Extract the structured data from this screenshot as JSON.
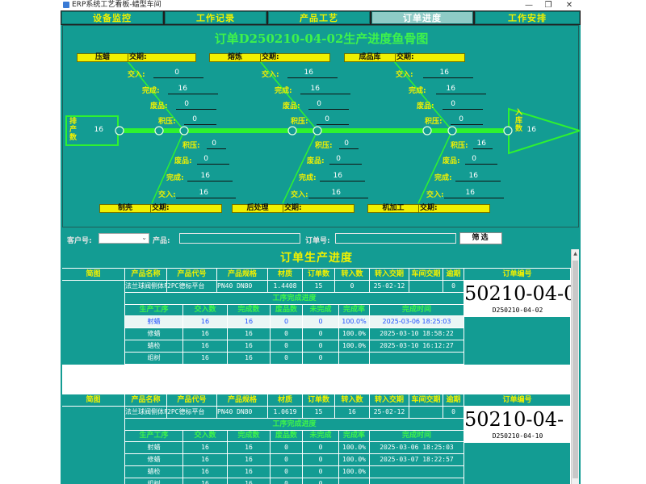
{
  "window": {
    "title": "ERP系统工艺看板-蜡型车间",
    "min_glyph": "—",
    "max_glyph": "❐",
    "close_glyph": "✕"
  },
  "tabs": [
    {
      "label": "设备监控",
      "active": false
    },
    {
      "label": "工作记录",
      "active": false
    },
    {
      "label": "产品工艺",
      "active": false
    },
    {
      "label": "订单进度",
      "active": true
    },
    {
      "label": "工作安排",
      "active": false
    }
  ],
  "fishbone": {
    "title": "订单D250210-04-02生产进度鱼骨图",
    "head": {
      "label": "排产数",
      "value": "16"
    },
    "tail": {
      "label": "入库数",
      "value": "16"
    },
    "date_label": "交期:",
    "top": [
      {
        "name": "压蜡",
        "date": "",
        "stats": [
          {
            "label": "交入:",
            "value": "0"
          },
          {
            "label": "完成:",
            "value": "16"
          },
          {
            "label": "废品:",
            "value": "0"
          },
          {
            "label": "积压:",
            "value": "0"
          }
        ]
      },
      {
        "name": "熔炼",
        "date": "",
        "stats": [
          {
            "label": "交入:",
            "value": "16"
          },
          {
            "label": "完成:",
            "value": "16"
          },
          {
            "label": "废品:",
            "value": "0"
          },
          {
            "label": "积压:",
            "value": "0"
          }
        ]
      },
      {
        "name": "成品库",
        "date": "",
        "stats": [
          {
            "label": "交入:",
            "value": "16"
          },
          {
            "label": "完成:",
            "value": "16"
          },
          {
            "label": "废品:",
            "value": "0"
          },
          {
            "label": "积压:",
            "value": "0"
          }
        ]
      }
    ],
    "bottom": [
      {
        "name": "制壳",
        "date": "",
        "stats": [
          {
            "label": "积压:",
            "value": "0"
          },
          {
            "label": "废品:",
            "value": "0"
          },
          {
            "label": "完成:",
            "value": "16"
          },
          {
            "label": "交入:",
            "value": "16"
          }
        ]
      },
      {
        "name": "后处理",
        "date": "",
        "stats": [
          {
            "label": "积压:",
            "value": "0"
          },
          {
            "label": "废品:",
            "value": "0"
          },
          {
            "label": "完成:",
            "value": "16"
          },
          {
            "label": "交入:",
            "value": "16"
          }
        ]
      },
      {
        "name": "机加工",
        "date": "",
        "stats": [
          {
            "label": "积压:",
            "value": "16"
          },
          {
            "label": "废品:",
            "value": "0"
          },
          {
            "label": "完成:",
            "value": "16"
          },
          {
            "label": "交入:",
            "value": "16"
          }
        ]
      }
    ],
    "colors": {
      "spine": "#2ef230",
      "label": "#f0f000",
      "box": "#f0f000"
    }
  },
  "filter": {
    "customer_label": "客户号:",
    "customer_value": "",
    "product_label": "产品:",
    "product_value": "",
    "order_label": "订单号:",
    "order_value": "",
    "button_label": "筛选"
  },
  "panel": {
    "title": "订单生产进度",
    "headers": [
      "简图",
      "产品名称",
      "产品代号",
      "产品规格",
      "材质",
      "订单数",
      "转入数",
      "转入交期",
      "车间交期",
      "逾期",
      "订单编号"
    ],
    "sub_title": "工序完成进度",
    "sub_headers": [
      "生产工序",
      "交入数",
      "完成数",
      "废品数",
      "未完成",
      "完成率",
      "完成时间"
    ],
    "orders": [
      {
        "row": [
          "",
          "法兰球阀侧体FB-",
          "2PC德标平台",
          "PN40 DN80",
          "1.4408",
          "15",
          "0",
          "25-02-12",
          "",
          "0"
        ],
        "code_big": "50210-04-0",
        "code": "D250210-04-02",
        "steps": [
          [
            "射蜡",
            "16",
            "16",
            "0",
            "0",
            "100.0%",
            "2025-03-06 18:25:03"
          ],
          [
            "修蜡",
            "16",
            "16",
            "0",
            "0",
            "100.0%",
            "2025-03-10 18:58:22"
          ],
          [
            "蜡检",
            "16",
            "16",
            "0",
            "0",
            "100.0%",
            "2025-03-10 16:12:27"
          ],
          [
            "组树",
            "16",
            "16",
            "0",
            "0",
            "",
            ""
          ]
        ]
      },
      {
        "row": [
          "",
          "法兰球阀侧体FB-",
          "2PC德标平台",
          "PN40 DN80",
          "1.0619",
          "15",
          "16",
          "25-02-12",
          "",
          "0"
        ],
        "code_big": "50210-04-",
        "code": "D250210-04-10",
        "steps": [
          [
            "射蜡",
            "16",
            "16",
            "0",
            "0",
            "100.0%",
            "2025-03-06 18:25:03"
          ],
          [
            "修蜡",
            "16",
            "16",
            "0",
            "0",
            "100.0%",
            "2025-03-07 18:22:57"
          ],
          [
            "蜡检",
            "16",
            "16",
            "0",
            "0",
            "100.0%",
            ""
          ],
          [
            "组树",
            "16",
            "16",
            "0",
            "0",
            "",
            ""
          ]
        ]
      }
    ]
  }
}
